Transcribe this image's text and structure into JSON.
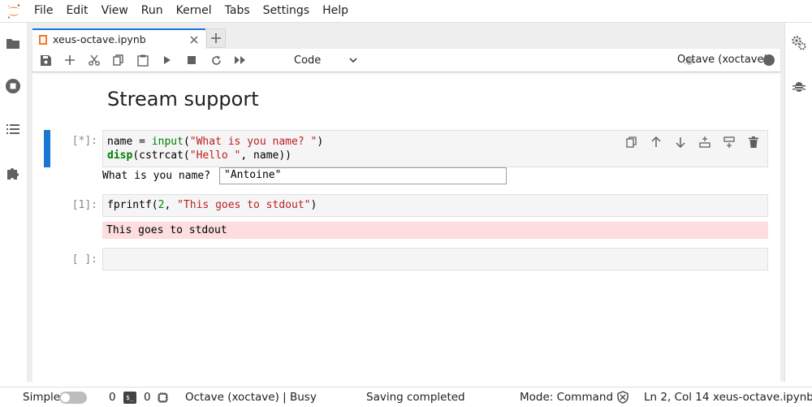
{
  "menubar": {
    "items": [
      "File",
      "Edit",
      "View",
      "Run",
      "Kernel",
      "Tabs",
      "Settings",
      "Help"
    ]
  },
  "tab": {
    "label": "xeus-octave.ipynb",
    "new_tab_symbol": "+"
  },
  "toolbar": {
    "cell_type": "Code",
    "kernel_name": "Octave (xoctave)"
  },
  "notebook": {
    "heading": "Stream support",
    "cell1": {
      "prompt": "[*]:",
      "line1": {
        "var": "name",
        "op": " = ",
        "fn": "input",
        "p1": "(",
        "str": "\"What is you name? \"",
        "p2": ")"
      },
      "line2": {
        "kw": "disp",
        "p1": "(cstrcat(",
        "str": "\"Hello \"",
        "rest": ", name))"
      },
      "stdin_prompt": "What is you name?",
      "stdin_value": "\"Antoine\""
    },
    "cell2": {
      "prompt": "[1]:",
      "code": {
        "fn": "fprintf",
        "p1": "(",
        "num": "2",
        "sep": ", ",
        "str": "\"This goes to stdout\"",
        "p2": ")"
      },
      "stderr": "This goes to stdout"
    },
    "cell3": {
      "prompt": "[ ]:"
    }
  },
  "statusbar": {
    "simple_label": "Simple",
    "terminals_count": "0",
    "kernels_count": "0",
    "kernel_status": "Octave (xoctave) | Busy",
    "save_status": "Saving completed",
    "mode": "Mode: Command",
    "cursor": "Ln 2, Col 14",
    "filename": "xeus-octave.ipynb"
  },
  "icons": {
    "accent": "#1976d2",
    "logo": "jupyter-logo-icon"
  }
}
